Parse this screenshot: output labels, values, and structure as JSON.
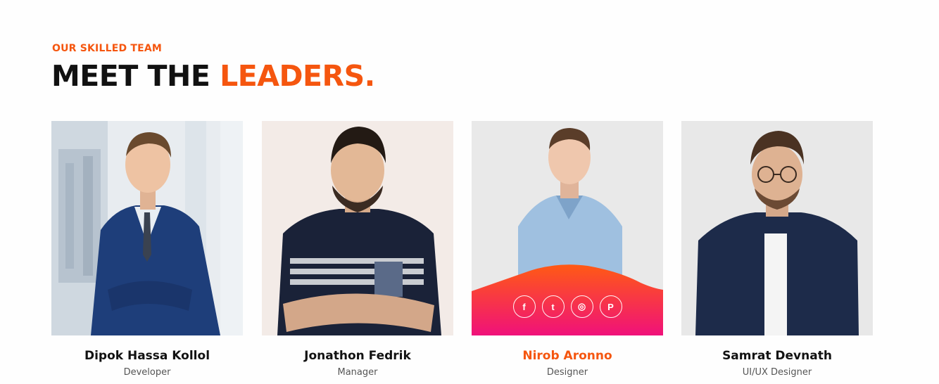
{
  "section": {
    "subtitle": "OUR SKILLED TEAM",
    "title_part1": "MEET THE ",
    "title_part2": "LEADERS."
  },
  "team": [
    {
      "name": "Dipok Hassa Kollol",
      "role": "Developer"
    },
    {
      "name": "Jonathon Fedrik",
      "role": "Manager"
    },
    {
      "name": "Nirob Aronno",
      "role": "Designer"
    },
    {
      "name": "Samrat Devnath",
      "role": "UI/UX Designer"
    }
  ],
  "social_icons": [
    {
      "icon": "facebook-icon",
      "glyph": "f"
    },
    {
      "icon": "twitter-icon",
      "glyph": "t"
    },
    {
      "icon": "instagram-icon",
      "glyph": "◎"
    },
    {
      "icon": "pinterest-icon",
      "glyph": "P"
    }
  ],
  "colors": {
    "accent": "#f5560f",
    "overlay_top": "#ff5a14",
    "overlay_bottom": "#f0117a"
  }
}
